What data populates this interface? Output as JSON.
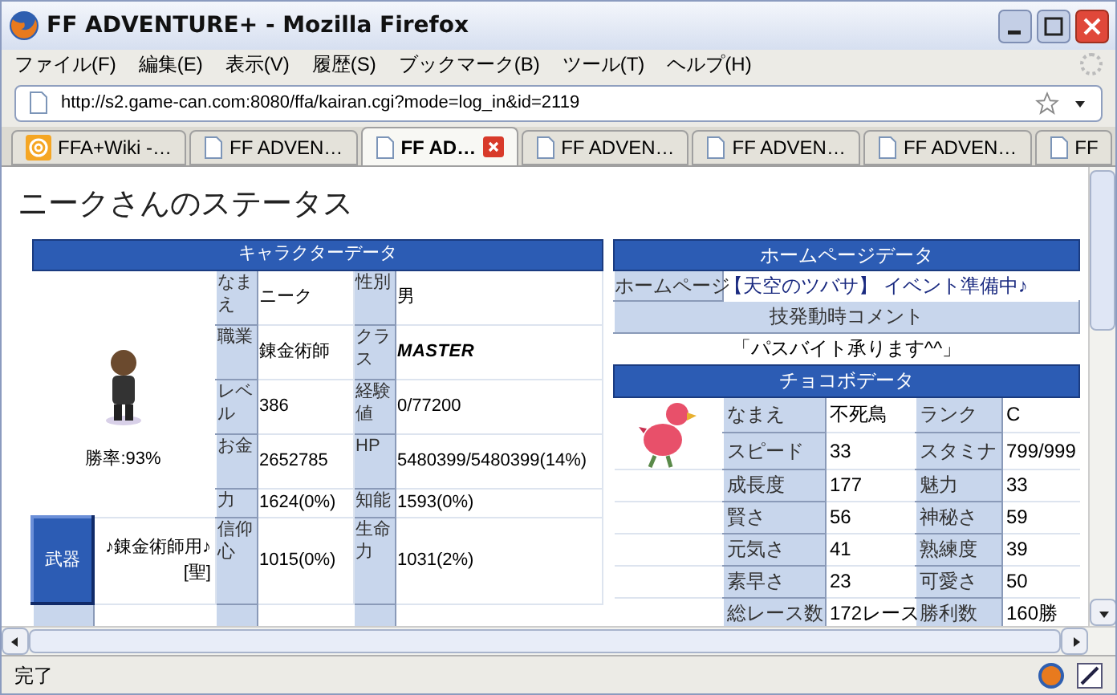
{
  "window": {
    "title": "FF ADVENTURE+ - Mozilla Firefox"
  },
  "menu": [
    "ファイル(F)",
    "編集(E)",
    "表示(V)",
    "履歴(S)",
    "ブックマーク(B)",
    "ツール(T)",
    "ヘルプ(H)"
  ],
  "address": {
    "url": "http://s2.game-can.com:8080/ffa/kairan.cgi?mode=log_in&id=2119"
  },
  "tabs": [
    {
      "label": "FFA+Wiki -…",
      "selected": false,
      "kind": "wiki"
    },
    {
      "label": "FF ADVEN…",
      "selected": false,
      "kind": "page"
    },
    {
      "label": "FF AD…",
      "selected": true,
      "kind": "page"
    },
    {
      "label": "FF ADVEN…",
      "selected": false,
      "kind": "page"
    },
    {
      "label": "FF ADVEN…",
      "selected": false,
      "kind": "page"
    },
    {
      "label": "FF ADVEN…",
      "selected": false,
      "kind": "page"
    },
    {
      "label": "FF",
      "selected": false,
      "kind": "page"
    }
  ],
  "page": {
    "heading": "ニークさんのステータス",
    "character": {
      "title": "キャラクターデータ",
      "win_rate": "勝率:93%",
      "rows": [
        [
          {
            "label": "なまえ",
            "value": "ニーク",
            "kind": "plain"
          },
          {
            "label": "性別",
            "value": "男",
            "kind": "plain"
          }
        ],
        [
          {
            "label": "職業",
            "value": "錬金術師",
            "kind": "plain"
          },
          {
            "label": "クラス",
            "value": "MASTER",
            "kind": "class"
          }
        ],
        [
          {
            "label": "レベル",
            "value": "386",
            "kind": "plain"
          },
          {
            "label": "経験値",
            "value": "0/77200",
            "kind": "plain"
          }
        ],
        [
          {
            "label": "お金",
            "value": "2652785",
            "kind": "plain"
          },
          {
            "label": "HP",
            "value": "5480399/5480399(14%)",
            "kind": "plain"
          }
        ],
        [
          {
            "label": "力",
            "value": "1624(0%)",
            "kind": "plain"
          },
          {
            "label": "知能",
            "value": "1593(0%)",
            "kind": "plain"
          }
        ],
        [
          {
            "label": "信仰心",
            "value": "1015(0%)",
            "kind": "plain"
          },
          {
            "label": "生命力",
            "value": "1031(2%)",
            "kind": "plain"
          }
        ]
      ],
      "weapon": {
        "label": "武器",
        "value": "♪錬金術師用♪ [聖]"
      }
    },
    "homepage": {
      "title": "ホームページデータ",
      "label": "ホームページ",
      "value": "【天空のツバサ】 イベント準備中♪",
      "comment_title": "技発動時コメント",
      "comment": "「パスバイト承ります^^」"
    },
    "chocobo": {
      "title": "チョコボデータ",
      "rows": [
        [
          {
            "label": "なまえ",
            "value": "不死鳥"
          },
          {
            "label": "ランク",
            "value": "C"
          }
        ],
        [
          {
            "label": "スピード",
            "value": "33"
          },
          {
            "label": "スタミナ",
            "value": "799/999"
          }
        ],
        [
          {
            "label": "成長度",
            "value": "177"
          },
          {
            "label": "魅力",
            "value": "33"
          }
        ],
        [
          {
            "label": "賢さ",
            "value": "56"
          },
          {
            "label": "神秘さ",
            "value": "59"
          }
        ],
        [
          {
            "label": "元気さ",
            "value": "41"
          },
          {
            "label": "熟練度",
            "value": "39"
          }
        ],
        [
          {
            "label": "素早さ",
            "value": "23"
          },
          {
            "label": "可愛さ",
            "value": "50"
          }
        ],
        [
          {
            "label": "総レース数",
            "value": "172レース"
          },
          {
            "label": "勝利数",
            "value": "160勝"
          }
        ]
      ]
    }
  },
  "status_bar": {
    "text": "完了"
  }
}
